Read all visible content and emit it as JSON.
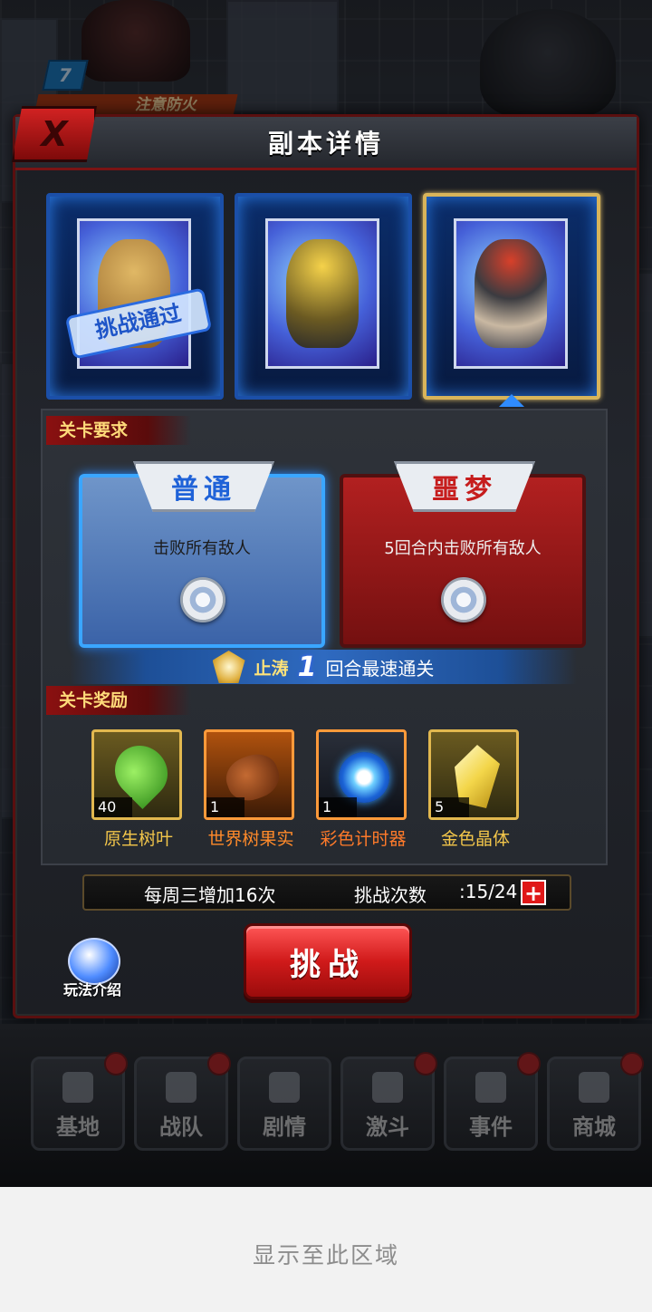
{
  "background": {
    "level_badge": "7",
    "banner_text": "注意防火"
  },
  "dialog": {
    "title": "副本详情",
    "close_label": "X"
  },
  "bosses": [
    {
      "name": "boss-1",
      "cleared": true,
      "cleared_stamp": "挑战通过",
      "selected": false
    },
    {
      "name": "boss-2",
      "cleared": false,
      "selected": false
    },
    {
      "name": "boss-3",
      "cleared": false,
      "selected": true
    }
  ],
  "requirements": {
    "section_title": "关卡要求",
    "normal": {
      "label": "普通",
      "desc": "击败所有敌人"
    },
    "nightmare": {
      "label": "噩梦",
      "desc": "5回合内击败所有敌人"
    },
    "fastest": {
      "prefix": "止涛",
      "rounds": "1",
      "suffix": "回合最速通关"
    }
  },
  "rewards": {
    "section_title": "关卡奖励",
    "items": [
      {
        "name": "原生树叶",
        "count": "40",
        "color": "#f3c64a"
      },
      {
        "name": "世界树果实",
        "count": "1",
        "color": "#ff8a2a"
      },
      {
        "name": "彩色计时器",
        "count": "1",
        "color": "#ff7a2a"
      },
      {
        "name": "金色晶体",
        "count": "5",
        "color": "#f3c64a"
      }
    ]
  },
  "challenge": {
    "weekly_note": "每周三增加16次",
    "count_label": "挑战次数",
    "count_value": ":15/24",
    "button_label": "挑战",
    "help_label": "玩法介绍"
  },
  "bottom_nav": [
    {
      "label": "基地",
      "has_dot": true
    },
    {
      "label": "战队",
      "has_dot": true
    },
    {
      "label": "剧情",
      "has_dot": false
    },
    {
      "label": "激斗",
      "has_dot": true
    },
    {
      "label": "事件",
      "has_dot": true
    },
    {
      "label": "商城",
      "has_dot": true
    }
  ],
  "footer": {
    "text": "显示至此区域"
  }
}
